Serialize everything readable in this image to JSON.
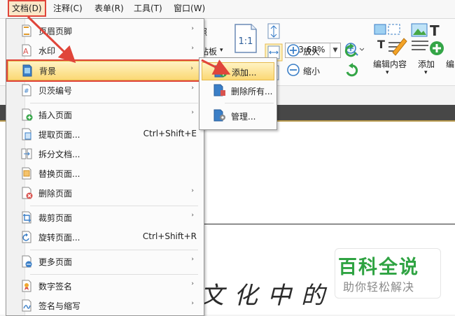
{
  "menubar": {
    "items": [
      "文档(D)",
      "注释(C)",
      "表单(R)",
      "工具(T)",
      "窗口(W)"
    ]
  },
  "toolbar": {
    "frag_left": "照",
    "paste_label": "粘板",
    "paste_arrow": "▾",
    "zoom_value": "123.68%",
    "zoom_in_label": "放大",
    "zoom_out_label": "缩小",
    "edit_content_label": "编辑内容",
    "add_label": "添加",
    "frag_right": "编"
  },
  "menu": {
    "items": [
      {
        "label": "页眉页脚",
        "shortcut": "",
        "arrow": "›"
      },
      {
        "label": "水印",
        "shortcut": "",
        "arrow": "›"
      },
      {
        "label": "背景",
        "shortcut": "",
        "arrow": "›"
      },
      {
        "label": "贝茨编号",
        "shortcut": "",
        "arrow": "›"
      },
      {
        "label": "插入页面",
        "shortcut": "",
        "arrow": "›"
      },
      {
        "label": "提取页面...",
        "shortcut": "Ctrl+Shift+E",
        "arrow": ""
      },
      {
        "label": "拆分文档...",
        "shortcut": "",
        "arrow": ""
      },
      {
        "label": "替换页面...",
        "shortcut": "",
        "arrow": ""
      },
      {
        "label": "删除页面",
        "shortcut": "",
        "arrow": "›"
      },
      {
        "label": "裁剪页面",
        "shortcut": "",
        "arrow": "›"
      },
      {
        "label": "旋转页面...",
        "shortcut": "Ctrl+Shift+R",
        "arrow": ""
      },
      {
        "label": "更多页面",
        "shortcut": "",
        "arrow": "›"
      },
      {
        "label": "数字签名",
        "shortcut": "",
        "arrow": "›"
      },
      {
        "label": "签名与缩写",
        "shortcut": "",
        "arrow": "›"
      }
    ]
  },
  "submenu": {
    "items": [
      {
        "label": "添加..."
      },
      {
        "label": "删除所有..."
      },
      {
        "label": "管理..."
      }
    ]
  },
  "document": {
    "handwriting": "文化中的"
  },
  "watermark": {
    "title": "百科全说",
    "subtitle": "助你轻松解决"
  },
  "colors": {
    "highlight_border": "#e0453a",
    "menu_highlight": "#fbd874",
    "watermark_green": "#2fa342"
  }
}
